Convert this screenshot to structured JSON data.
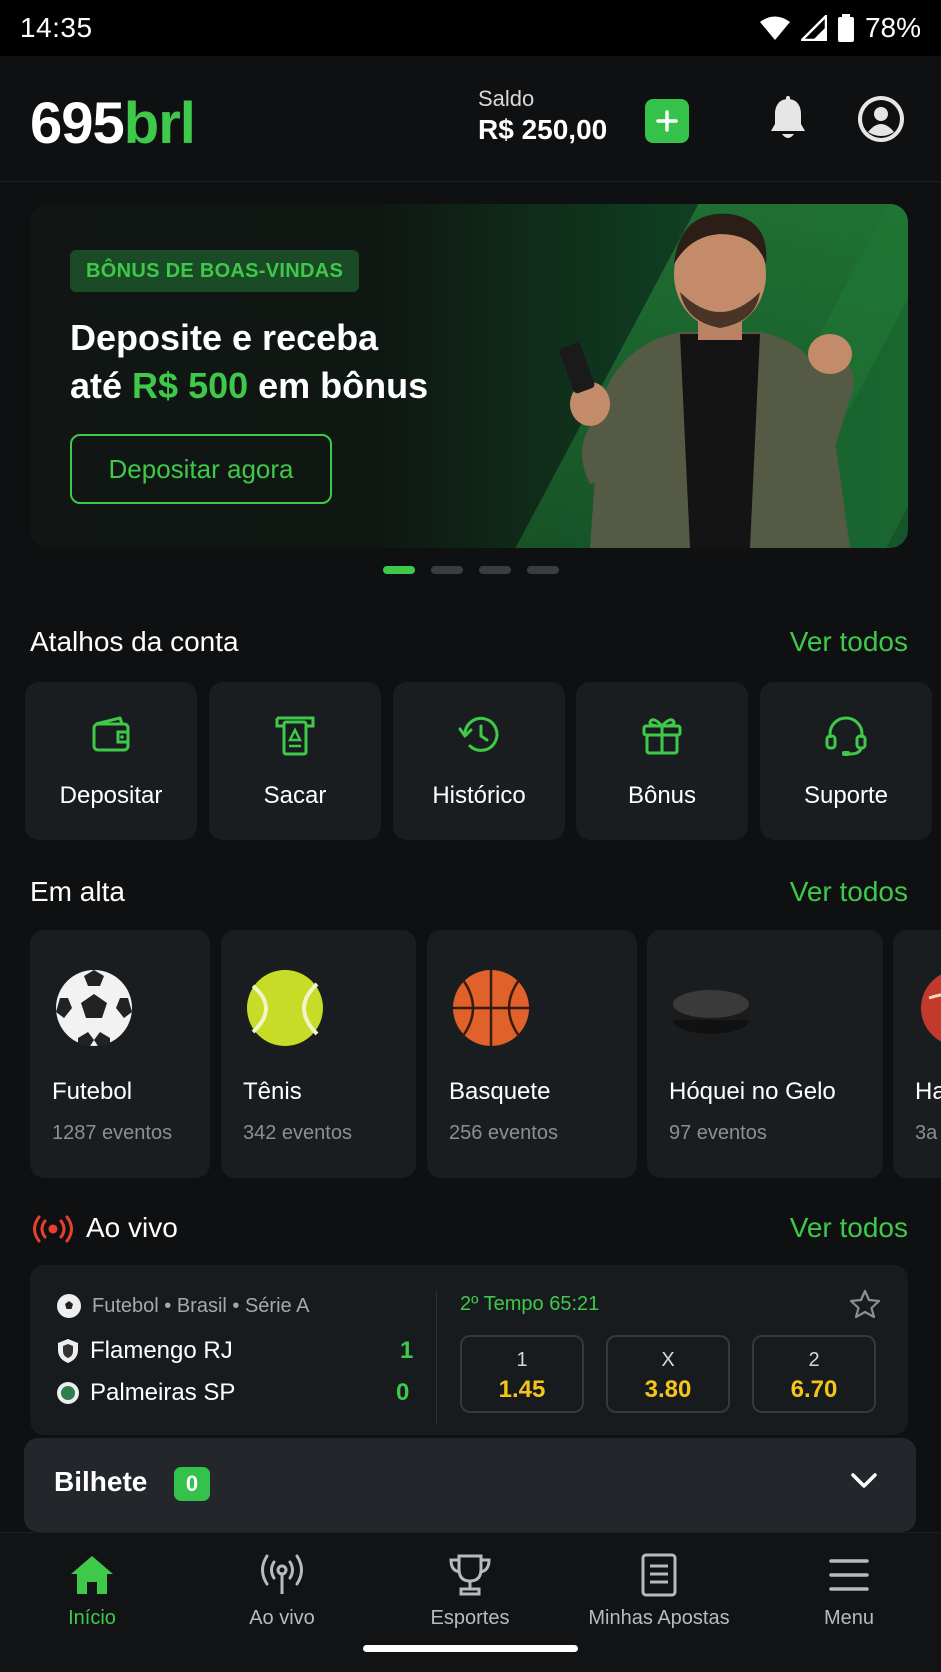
{
  "status": {
    "time": "14:35",
    "battery": "78%"
  },
  "header": {
    "logo_num": "695",
    "logo_brl": "brl",
    "saldo_label": "Saldo",
    "saldo_value": "R$ 250,00"
  },
  "banner": {
    "badge": "BÔNUS DE BOAS-VINDAS",
    "line1": "Deposite e receba",
    "line2_pre": "até ",
    "line2_amount": "R$ 500",
    "line2_post": " em bônus",
    "cta": "Depositar agora",
    "slides": 4,
    "active_slide": 1
  },
  "shortcuts": {
    "title": "Atalhos da conta",
    "link": "Ver todos",
    "items": [
      {
        "label": "Depositar",
        "icon": "wallet-icon"
      },
      {
        "label": "Sacar",
        "icon": "withdraw-icon"
      },
      {
        "label": "Histórico",
        "icon": "history-icon"
      },
      {
        "label": "Bônus",
        "icon": "gift-icon"
      },
      {
        "label": "Suporte",
        "icon": "headset-icon"
      }
    ]
  },
  "trending": {
    "title": "Em alta",
    "link": "Ver todos",
    "items": [
      {
        "name": "Futebol",
        "count": "1287 eventos",
        "icon": "soccer-ball-icon"
      },
      {
        "name": "Tênis",
        "count": "342 eventos",
        "icon": "tennis-ball-icon"
      },
      {
        "name": "Basquete",
        "count": "256 eventos",
        "icon": "basketball-icon"
      },
      {
        "name": "Hóquei no Gelo",
        "count": "97 eventos",
        "icon": "hockey-puck-icon"
      },
      {
        "name": "Ha",
        "count": "3a",
        "icon": "handball-icon"
      }
    ]
  },
  "live": {
    "title": "Ao vivo",
    "link": "Ver todos",
    "match": {
      "league": "Futebol • Brasil • Série A",
      "period": "2º Tempo 65:21",
      "home": {
        "name": "Flamengo RJ",
        "score": "1"
      },
      "away": {
        "name": "Palmeiras SP",
        "score": "0"
      },
      "odds": [
        {
          "label": "1",
          "value": "1.45"
        },
        {
          "label": "X",
          "value": "3.80"
        },
        {
          "label": "2",
          "value": "6.70"
        }
      ]
    }
  },
  "bilhete": {
    "title": "Bilhete",
    "count": "0"
  },
  "tabs": [
    {
      "label": "Início",
      "icon": "home-icon",
      "active": true
    },
    {
      "label": "Ao vivo",
      "icon": "broadcast-icon",
      "active": false
    },
    {
      "label": "Esportes",
      "icon": "trophy-icon",
      "active": false
    },
    {
      "label": "Minhas Apostas",
      "icon": "document-icon",
      "active": false
    },
    {
      "label": "Menu",
      "icon": "menu-icon",
      "active": false
    }
  ],
  "colors": {
    "accent": "#3ec94a",
    "background": "#0e1012",
    "card": "#1a1d20",
    "odds": "#f5c518",
    "live": "#e8402f"
  }
}
